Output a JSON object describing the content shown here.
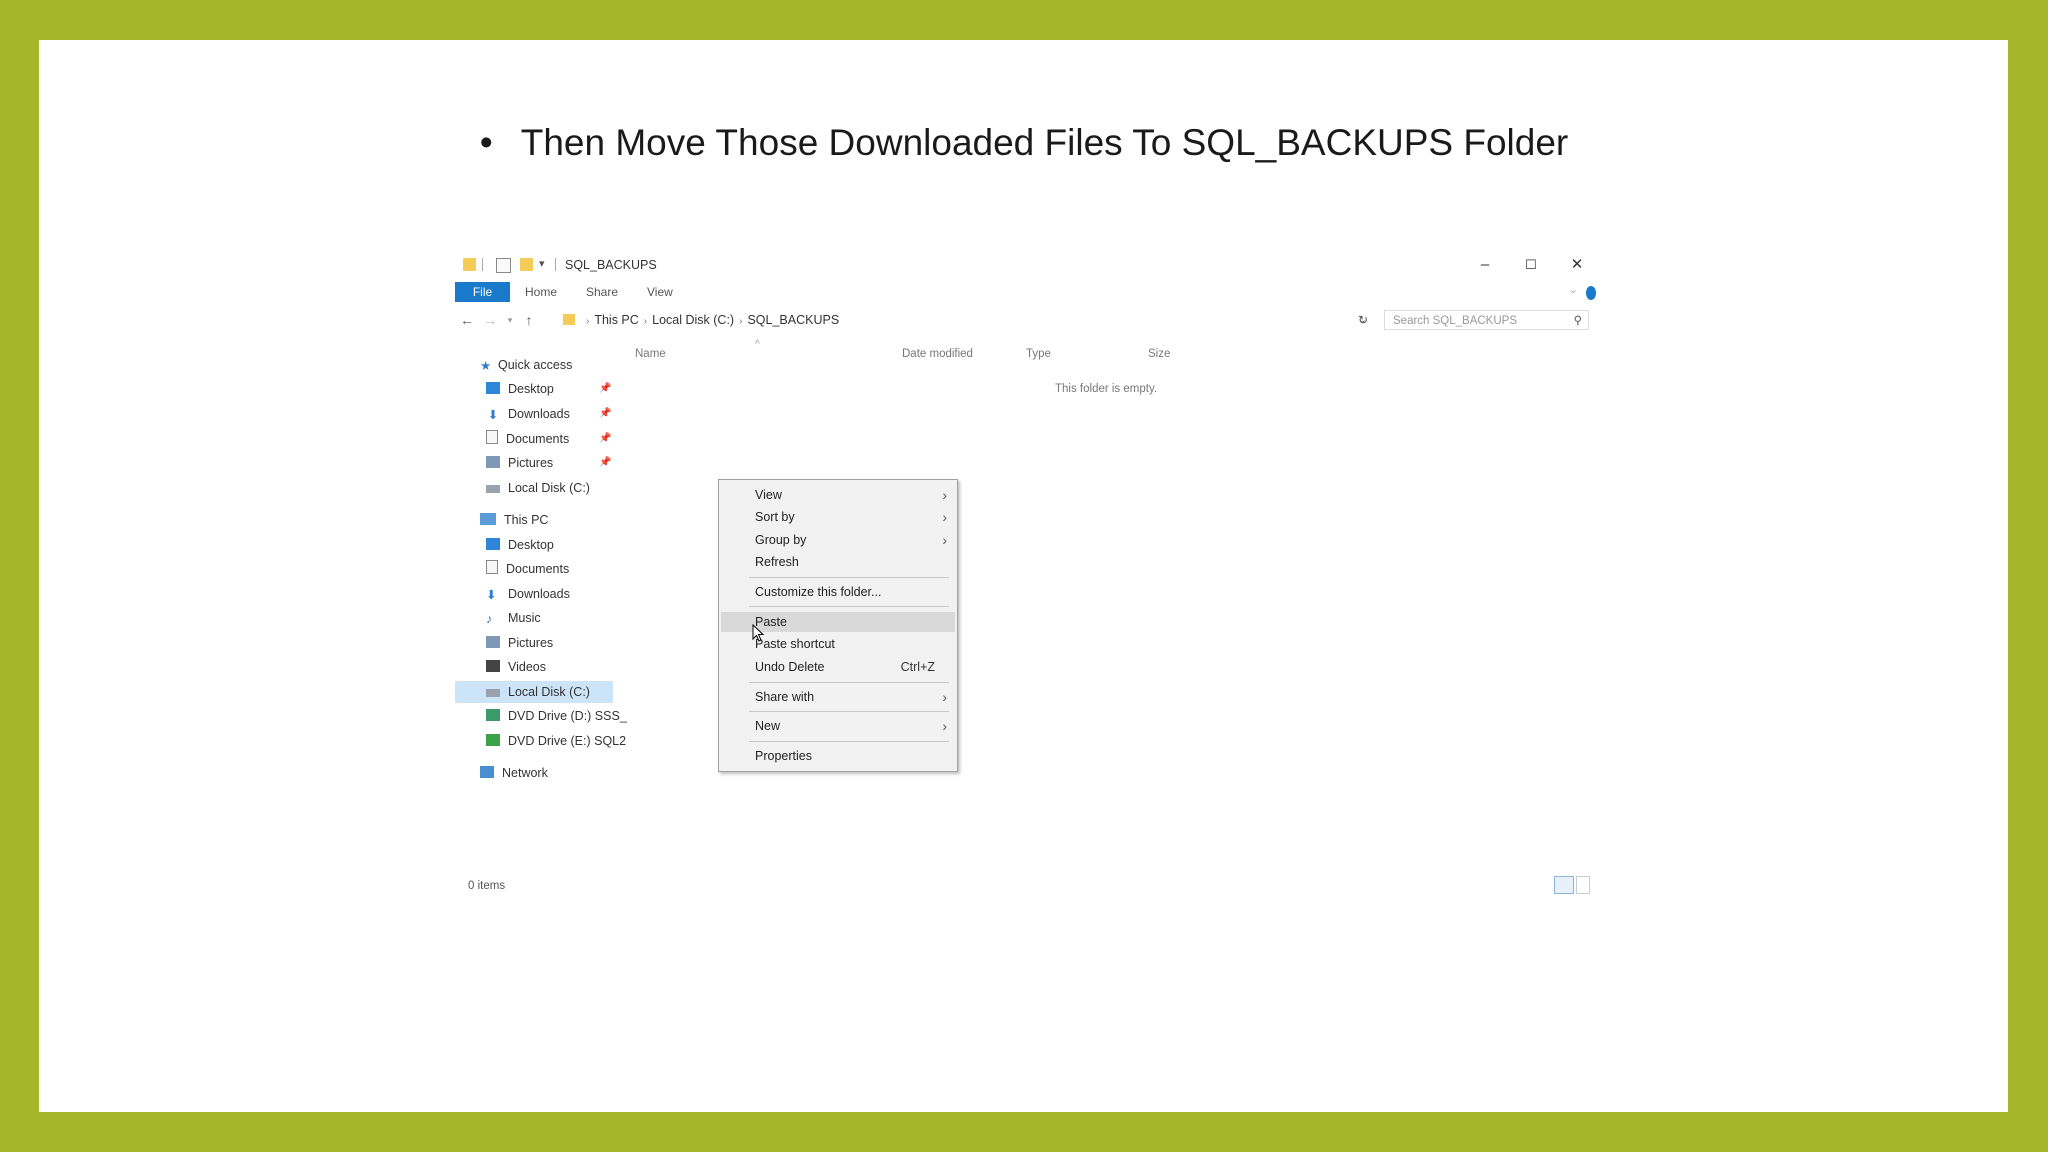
{
  "slide": {
    "bullet": "•",
    "headline": "Then Move Those Downloaded Files To SQL_BACKUPS Folder"
  },
  "explorer": {
    "window_title": "SQL_BACKUPS",
    "controls": {
      "minimize": "–",
      "maximize": "☐",
      "close": "✕"
    },
    "ribbon_tabs": [
      "File",
      "Home",
      "Share",
      "View"
    ],
    "breadcrumb": [
      "This PC",
      "Local Disk (C:)",
      "SQL_BACKUPS"
    ],
    "search_placeholder": "Search SQL_BACKUPS",
    "nav": {
      "quick_access": "Quick access",
      "quick_items": [
        "Desktop",
        "Downloads",
        "Documents",
        "Pictures",
        "Local Disk (C:)"
      ],
      "this_pc": "This PC",
      "pc_items": [
        "Desktop",
        "Documents",
        "Downloads",
        "Music",
        "Pictures",
        "Videos",
        "Local Disk (C:)",
        "DVD Drive (D:) SSS_",
        "DVD Drive (E:) SQL2"
      ],
      "network": "Network",
      "selected": "Local Disk (C:)"
    },
    "columns": [
      "Name",
      "Date modified",
      "Type",
      "Size"
    ],
    "empty_message": "This folder is empty.",
    "status": "0 items"
  },
  "context_menu": {
    "items": [
      {
        "label": "View",
        "submenu": true
      },
      {
        "label": "Sort by",
        "submenu": true
      },
      {
        "label": "Group by",
        "submenu": true
      },
      {
        "label": "Refresh"
      },
      {
        "label": "Customize this folder..."
      },
      {
        "label": "Paste",
        "hovered": true
      },
      {
        "label": "Paste shortcut"
      },
      {
        "label": "Undo Delete",
        "shortcut": "Ctrl+Z"
      },
      {
        "label": "Share with",
        "submenu": true
      },
      {
        "label": "New",
        "submenu": true
      },
      {
        "label": "Properties"
      }
    ]
  },
  "colors": {
    "frame": "#a6b52a",
    "file_tab": "#1979ca",
    "folder": "#f4cb57"
  }
}
